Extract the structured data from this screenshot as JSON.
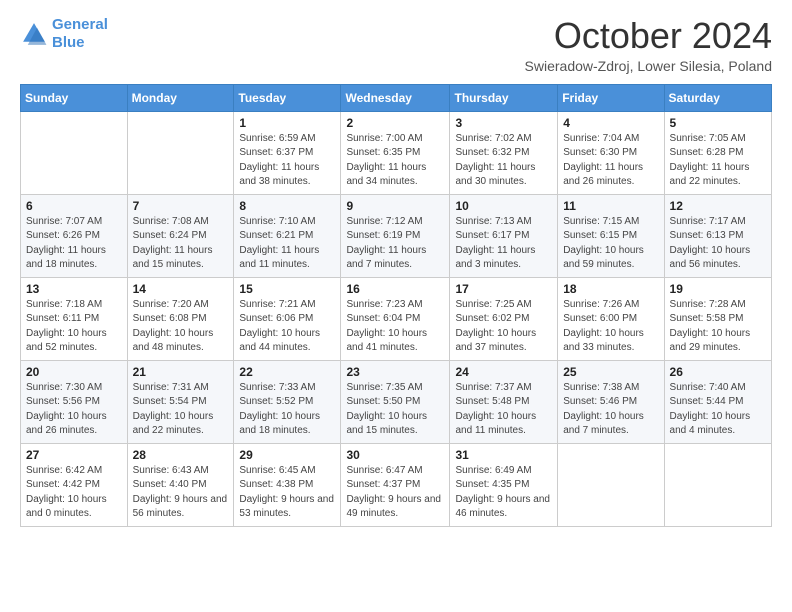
{
  "logo": {
    "line1": "General",
    "line2": "Blue"
  },
  "title": "October 2024",
  "subtitle": "Swieradow-Zdroj, Lower Silesia, Poland",
  "days_of_week": [
    "Sunday",
    "Monday",
    "Tuesday",
    "Wednesday",
    "Thursday",
    "Friday",
    "Saturday"
  ],
  "weeks": [
    [
      {
        "day": "",
        "info": ""
      },
      {
        "day": "",
        "info": ""
      },
      {
        "day": "1",
        "info": "Sunrise: 6:59 AM\nSunset: 6:37 PM\nDaylight: 11 hours and 38 minutes."
      },
      {
        "day": "2",
        "info": "Sunrise: 7:00 AM\nSunset: 6:35 PM\nDaylight: 11 hours and 34 minutes."
      },
      {
        "day": "3",
        "info": "Sunrise: 7:02 AM\nSunset: 6:32 PM\nDaylight: 11 hours and 30 minutes."
      },
      {
        "day": "4",
        "info": "Sunrise: 7:04 AM\nSunset: 6:30 PM\nDaylight: 11 hours and 26 minutes."
      },
      {
        "day": "5",
        "info": "Sunrise: 7:05 AM\nSunset: 6:28 PM\nDaylight: 11 hours and 22 minutes."
      }
    ],
    [
      {
        "day": "6",
        "info": "Sunrise: 7:07 AM\nSunset: 6:26 PM\nDaylight: 11 hours and 18 minutes."
      },
      {
        "day": "7",
        "info": "Sunrise: 7:08 AM\nSunset: 6:24 PM\nDaylight: 11 hours and 15 minutes."
      },
      {
        "day": "8",
        "info": "Sunrise: 7:10 AM\nSunset: 6:21 PM\nDaylight: 11 hours and 11 minutes."
      },
      {
        "day": "9",
        "info": "Sunrise: 7:12 AM\nSunset: 6:19 PM\nDaylight: 11 hours and 7 minutes."
      },
      {
        "day": "10",
        "info": "Sunrise: 7:13 AM\nSunset: 6:17 PM\nDaylight: 11 hours and 3 minutes."
      },
      {
        "day": "11",
        "info": "Sunrise: 7:15 AM\nSunset: 6:15 PM\nDaylight: 10 hours and 59 minutes."
      },
      {
        "day": "12",
        "info": "Sunrise: 7:17 AM\nSunset: 6:13 PM\nDaylight: 10 hours and 56 minutes."
      }
    ],
    [
      {
        "day": "13",
        "info": "Sunrise: 7:18 AM\nSunset: 6:11 PM\nDaylight: 10 hours and 52 minutes."
      },
      {
        "day": "14",
        "info": "Sunrise: 7:20 AM\nSunset: 6:08 PM\nDaylight: 10 hours and 48 minutes."
      },
      {
        "day": "15",
        "info": "Sunrise: 7:21 AM\nSunset: 6:06 PM\nDaylight: 10 hours and 44 minutes."
      },
      {
        "day": "16",
        "info": "Sunrise: 7:23 AM\nSunset: 6:04 PM\nDaylight: 10 hours and 41 minutes."
      },
      {
        "day": "17",
        "info": "Sunrise: 7:25 AM\nSunset: 6:02 PM\nDaylight: 10 hours and 37 minutes."
      },
      {
        "day": "18",
        "info": "Sunrise: 7:26 AM\nSunset: 6:00 PM\nDaylight: 10 hours and 33 minutes."
      },
      {
        "day": "19",
        "info": "Sunrise: 7:28 AM\nSunset: 5:58 PM\nDaylight: 10 hours and 29 minutes."
      }
    ],
    [
      {
        "day": "20",
        "info": "Sunrise: 7:30 AM\nSunset: 5:56 PM\nDaylight: 10 hours and 26 minutes."
      },
      {
        "day": "21",
        "info": "Sunrise: 7:31 AM\nSunset: 5:54 PM\nDaylight: 10 hours and 22 minutes."
      },
      {
        "day": "22",
        "info": "Sunrise: 7:33 AM\nSunset: 5:52 PM\nDaylight: 10 hours and 18 minutes."
      },
      {
        "day": "23",
        "info": "Sunrise: 7:35 AM\nSunset: 5:50 PM\nDaylight: 10 hours and 15 minutes."
      },
      {
        "day": "24",
        "info": "Sunrise: 7:37 AM\nSunset: 5:48 PM\nDaylight: 10 hours and 11 minutes."
      },
      {
        "day": "25",
        "info": "Sunrise: 7:38 AM\nSunset: 5:46 PM\nDaylight: 10 hours and 7 minutes."
      },
      {
        "day": "26",
        "info": "Sunrise: 7:40 AM\nSunset: 5:44 PM\nDaylight: 10 hours and 4 minutes."
      }
    ],
    [
      {
        "day": "27",
        "info": "Sunrise: 6:42 AM\nSunset: 4:42 PM\nDaylight: 10 hours and 0 minutes."
      },
      {
        "day": "28",
        "info": "Sunrise: 6:43 AM\nSunset: 4:40 PM\nDaylight: 9 hours and 56 minutes."
      },
      {
        "day": "29",
        "info": "Sunrise: 6:45 AM\nSunset: 4:38 PM\nDaylight: 9 hours and 53 minutes."
      },
      {
        "day": "30",
        "info": "Sunrise: 6:47 AM\nSunset: 4:37 PM\nDaylight: 9 hours and 49 minutes."
      },
      {
        "day": "31",
        "info": "Sunrise: 6:49 AM\nSunset: 4:35 PM\nDaylight: 9 hours and 46 minutes."
      },
      {
        "day": "",
        "info": ""
      },
      {
        "day": "",
        "info": ""
      }
    ]
  ]
}
